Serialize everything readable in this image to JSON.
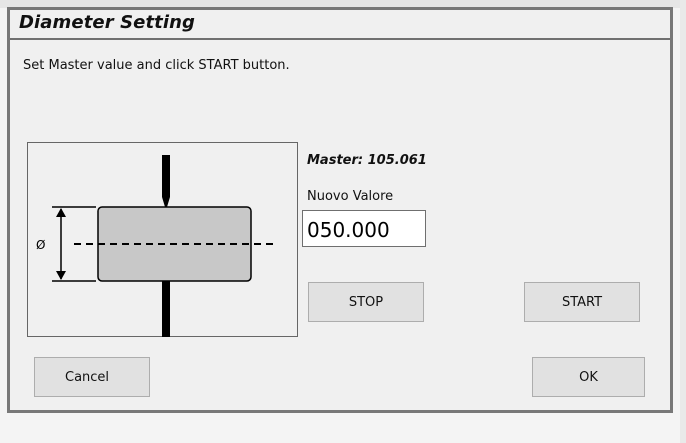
{
  "dialog": {
    "title": "Diameter Setting",
    "instruction": "Set Master value and click START button."
  },
  "diagram": {
    "diameter_symbol": "Ø"
  },
  "master": {
    "label": "Master: 105.061"
  },
  "nuovo": {
    "label": "Nuovo Valore",
    "value": "050.000"
  },
  "buttons": {
    "stop": "STOP",
    "start": "START",
    "cancel": "Cancel",
    "ok": "OK"
  }
}
